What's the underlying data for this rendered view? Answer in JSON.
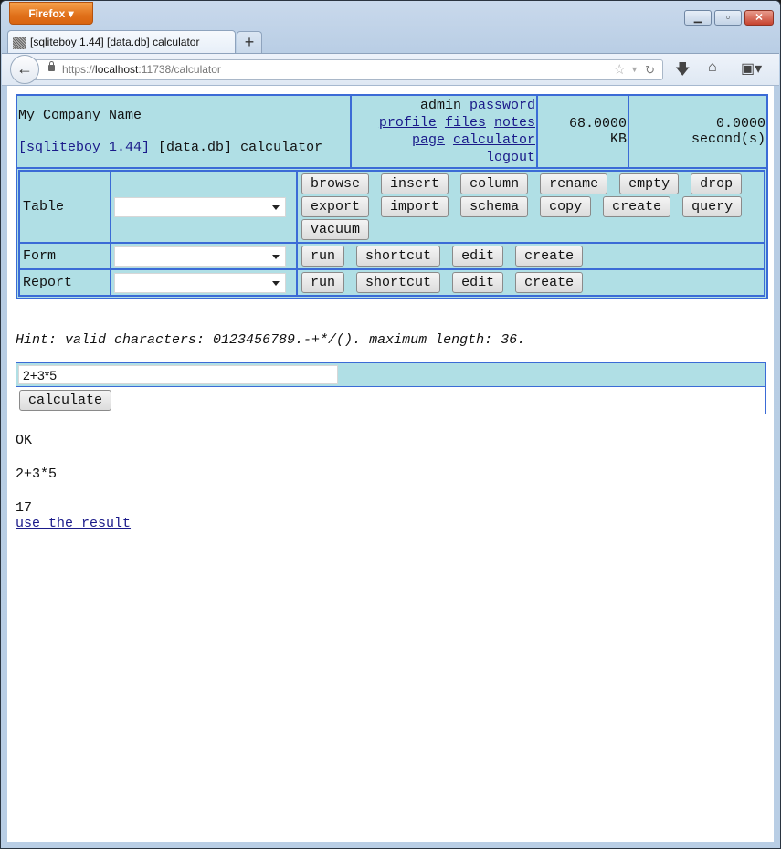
{
  "browser": {
    "menu_label": "Firefox",
    "window_controls": {
      "minimize": "minimize-icon",
      "maximize": "maximize-icon",
      "close": "close-icon"
    },
    "tab_title": "[sqliteboy 1.44] [data.db] calculator",
    "new_tab_label": "+",
    "url_prefix": "https://",
    "url_host": "localhost",
    "url_rest": ":11738/calculator"
  },
  "header": {
    "company": "My Company Name",
    "app_link": "[sqliteboy 1.44]",
    "db": "[data.db]",
    "page": "calculator",
    "user": "admin",
    "links": [
      "password",
      "profile",
      "files",
      "notes",
      "page",
      "calculator",
      "logout"
    ],
    "size_value": "68.0000",
    "size_unit": "KB",
    "time_value": "0.0000",
    "time_unit": "second(s)"
  },
  "tools": {
    "table": {
      "label": "Table",
      "selected": "",
      "buttons": [
        "browse",
        "insert",
        "column",
        "rename",
        "empty",
        "drop",
        "export",
        "import",
        "schema",
        "copy",
        "create",
        "query",
        "vacuum"
      ]
    },
    "form": {
      "label": "Form",
      "selected": "",
      "buttons": [
        "run",
        "shortcut",
        "edit",
        "create"
      ]
    },
    "report": {
      "label": "Report",
      "selected": "",
      "buttons": [
        "run",
        "shortcut",
        "edit",
        "create"
      ]
    }
  },
  "hint": "Hint: valid characters: 0123456789.-+*/(). maximum length: 36.",
  "calculator": {
    "expression": "2+3*5",
    "button": "calculate"
  },
  "result": {
    "status": "OK",
    "expression": "2+3*5",
    "value": "17",
    "use_link": "use the result"
  }
}
